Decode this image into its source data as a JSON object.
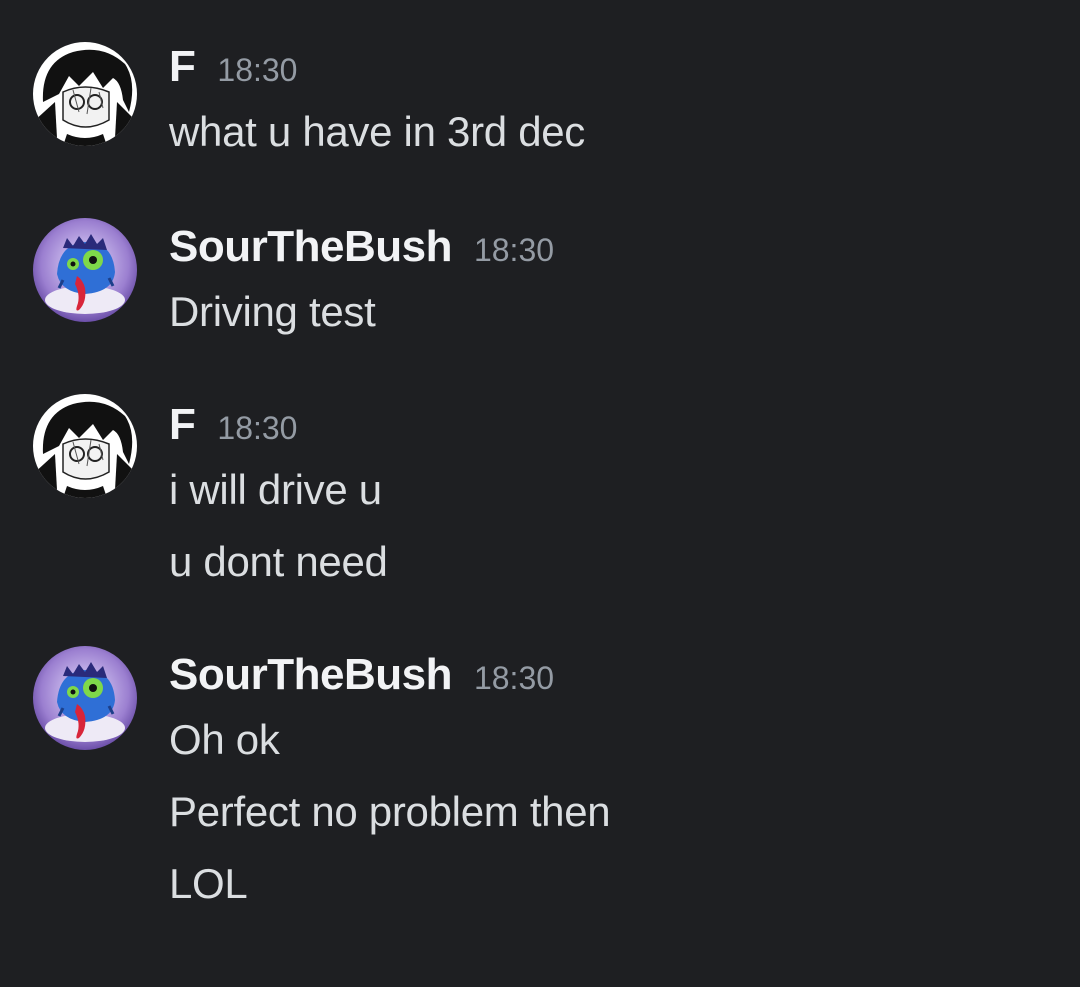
{
  "messages": [
    {
      "author": "F",
      "time": "18:30",
      "avatar": "manga-girl-avatar",
      "lines": [
        "what u have in 3rd dec"
      ]
    },
    {
      "author": "SourTheBush",
      "time": "18:30",
      "avatar": "blue-monster-avatar",
      "lines": [
        "Driving test"
      ]
    },
    {
      "author": "F",
      "time": "18:30",
      "avatar": "manga-girl-avatar",
      "lines": [
        "i will drive u",
        "u dont need"
      ]
    },
    {
      "author": "SourTheBush",
      "time": "18:30",
      "avatar": "blue-monster-avatar",
      "lines": [
        "Oh ok",
        "Perfect no problem then",
        "LOL"
      ]
    }
  ],
  "colors": {
    "background": "#1e1f22",
    "username": "#f2f3f5",
    "timestamp": "#949ba4",
    "message_text": "#dbdee1"
  }
}
